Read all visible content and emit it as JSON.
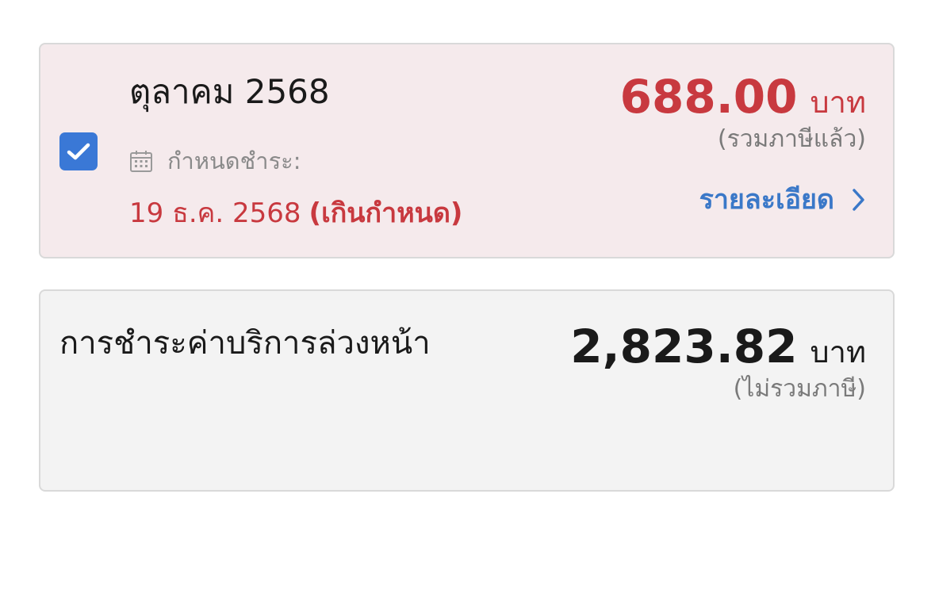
{
  "bill": {
    "checked": true,
    "month": "ตุลาคม 2568",
    "due_label": "กำหนดชำระ:",
    "due_date": "19 ธ.ค. 2568",
    "overdue_label": "(เกินกำหนด)",
    "amount": "688.00",
    "unit": "บาท",
    "tax_note": "(รวมภาษีแล้ว)",
    "details_label": "รายละเอียด",
    "icons": {
      "checkbox": "checkbox-checked-icon",
      "calendar": "calendar-icon",
      "chevron": "chevron-right-icon"
    }
  },
  "advance_payment": {
    "title": "การชำระค่าบริการล่วงหน้า",
    "amount": "2,823.82",
    "unit": "บาท",
    "tax_note": "(ไม่รวมภาษี)"
  },
  "colors": {
    "overdue_red": "#c8393f",
    "link_blue": "#3a78c8",
    "checkbox_blue": "#3a78d6",
    "bill_card_bg": "#f5eaec",
    "advance_card_bg": "#f3f3f3",
    "muted_text": "#7a7a7a"
  }
}
